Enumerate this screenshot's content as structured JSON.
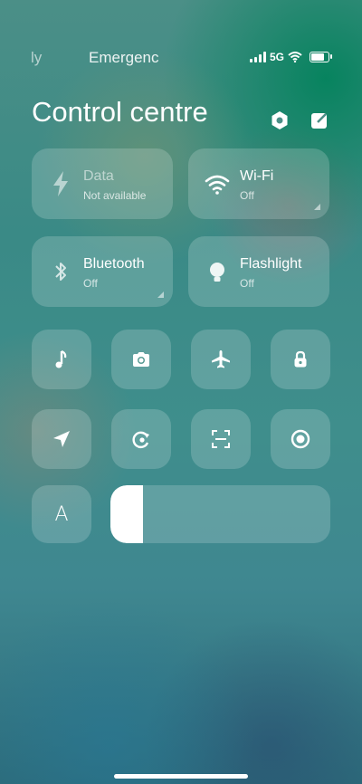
{
  "status_bar": {
    "left_partial": "ly",
    "carrier": "Emergenc",
    "network": "5G"
  },
  "header": {
    "title": "Control centre"
  },
  "tiles": [
    {
      "name": "Data",
      "status": "Not available"
    },
    {
      "name": "Wi-Fi",
      "status": "Off"
    },
    {
      "name": "Bluetooth",
      "status": "Off"
    },
    {
      "name": "Flashlight",
      "status": "Off"
    }
  ],
  "brightness": {
    "auto_label": "A",
    "level_fraction": 0.15
  }
}
